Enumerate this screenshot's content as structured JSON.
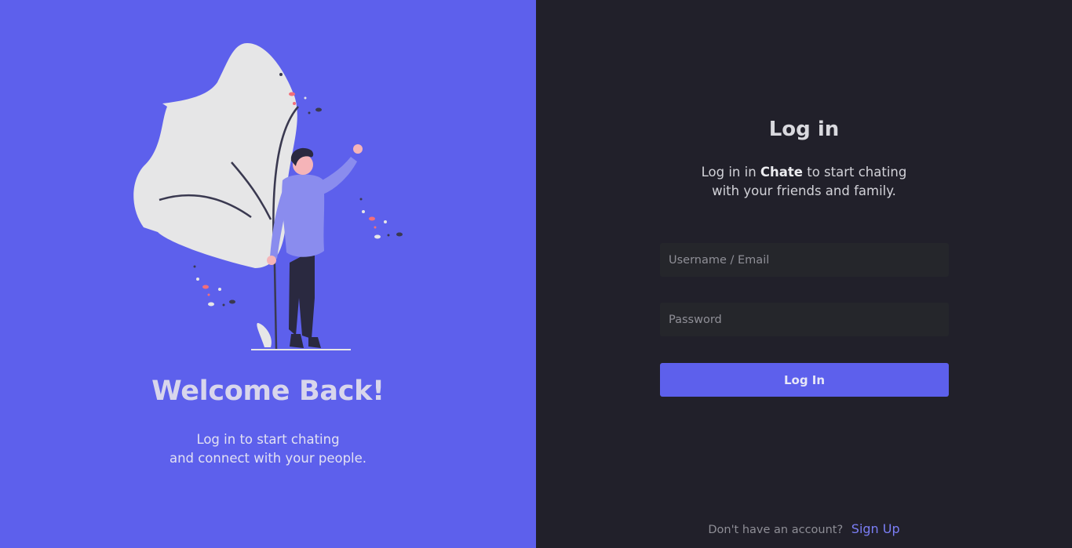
{
  "left_panel": {
    "title": "Welcome Back!",
    "subtitle_line1": "Log in to start chating",
    "subtitle_line2": "and connect with your people.",
    "bg_color": "#5d60ec"
  },
  "right_panel": {
    "title": "Log in",
    "desc_prefix": "Log in in",
    "brand": "Chate",
    "desc_suffix": "to start chating",
    "desc_line2": "with your friends and family.",
    "username_placeholder": "Username / Email",
    "password_placeholder": "Password",
    "submit_label": "Log In",
    "signup_prompt": "Don't have an account?",
    "signup_link": "Sign Up",
    "bg_color": "#21202a",
    "accent": "#5d60ec"
  }
}
